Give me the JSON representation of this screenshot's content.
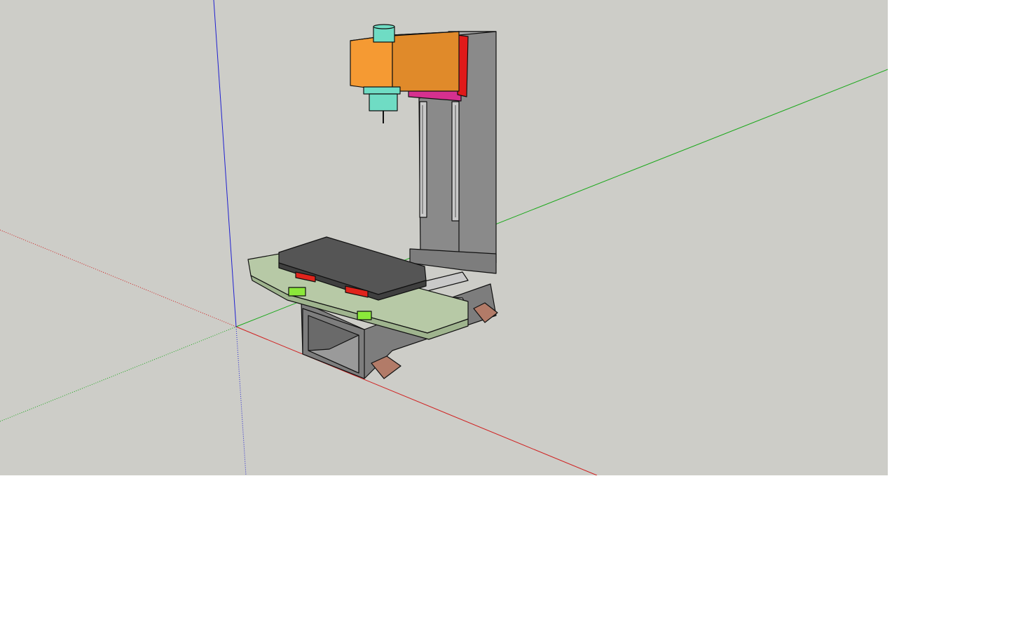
{
  "app": {
    "kind": "3d-modeling-viewport"
  },
  "viewport": {
    "background_color": "#cdcdc8",
    "page_background_color": "#ffffff",
    "axes": {
      "red_axis_color": "#d02020",
      "green_axis_color": "#1aa81a",
      "blue_axis_color": "#2020d0"
    }
  },
  "model": {
    "subject": "cnc-milling-machine",
    "parts": {
      "spindle_head_color": "#f59a33",
      "spindle_head_side_color": "#e08a2a",
      "spindle_motor_color": "#6fdcc4",
      "carriage_plate_color": "#d6308f",
      "carriage_red_color": "#e01a1a",
      "column_color": "#8a8a8a",
      "column_front_color": "#a6a6a6",
      "linear_rail_color": "#c9c9c9",
      "table_top_color": "#555555",
      "saddle_color": "#b7c9a6",
      "base_color": "#7d7d7d",
      "bearing_block_color": "#e0241c",
      "ballscrew_nut_color": "#8be83a",
      "leveling_foot_color": "#b27b68"
    }
  }
}
